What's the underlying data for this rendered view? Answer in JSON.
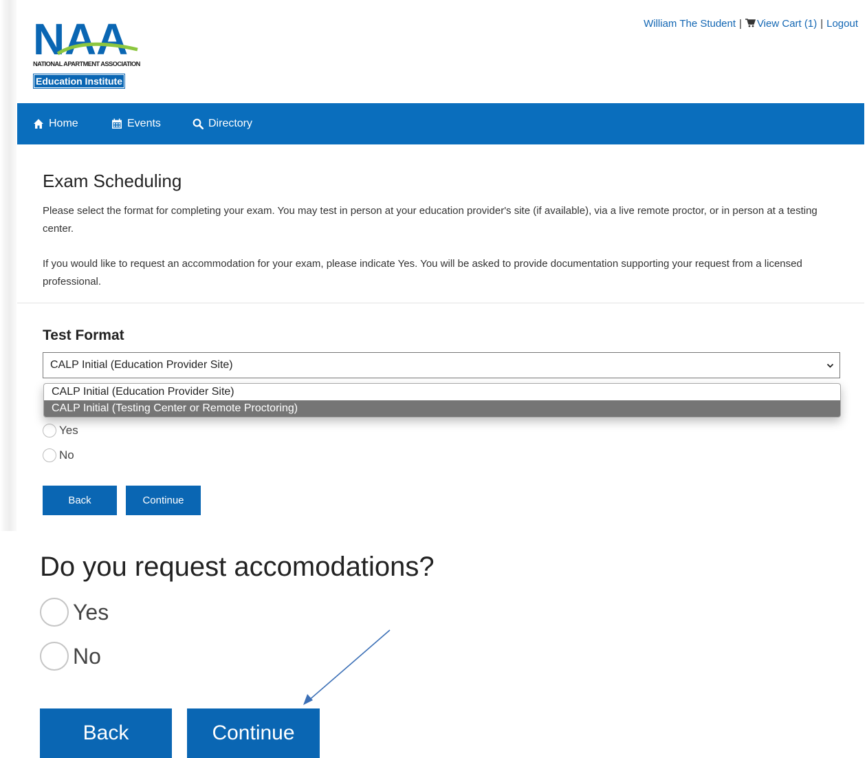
{
  "header": {
    "logo": {
      "letters": [
        "N",
        "A",
        "A"
      ],
      "association": "NATIONAL APARTMENT ASSOCIATION",
      "institute": "Education Institute"
    },
    "user_name": "William The Student",
    "separator": "|",
    "cart_label": "View Cart (1)",
    "logout_label": "Logout"
  },
  "nav": {
    "items": [
      {
        "label": "Home",
        "icon": "home-icon"
      },
      {
        "label": "Events",
        "icon": "calendar-icon"
      },
      {
        "label": "Directory",
        "icon": "search-icon"
      }
    ]
  },
  "main": {
    "title": "Exam Scheduling",
    "intro": "Please select the format for completing your exam. You may test in person at your education provider's site (if available), via a live remote proctor, or in person at a testing center.",
    "accommodation_note": "If you would like to request an accommodation for your exam, please indicate Yes.  You will be asked to provide documentation supporting your request from a licensed professional.",
    "test_format_label": "Test Format",
    "test_format_selected": "CALP Initial (Education Provider Site)",
    "test_format_options": [
      "CALP Initial (Education Provider Site)",
      "CALP Initial (Testing Center or Remote Proctoring)"
    ],
    "radio_yes": "Yes",
    "radio_no": "No",
    "back_label": "Back",
    "continue_label": "Continue"
  },
  "zoom": {
    "question": "Do you request accomodations?",
    "radio_yes": "Yes",
    "radio_no": "No",
    "back_label": "Back",
    "continue_label": "Continue"
  },
  "colors": {
    "brand_blue": "#0a66b3",
    "nav_blue": "#0a6ebd",
    "logo_green": "#8cc63f",
    "arrow": "#3b6fb6"
  }
}
